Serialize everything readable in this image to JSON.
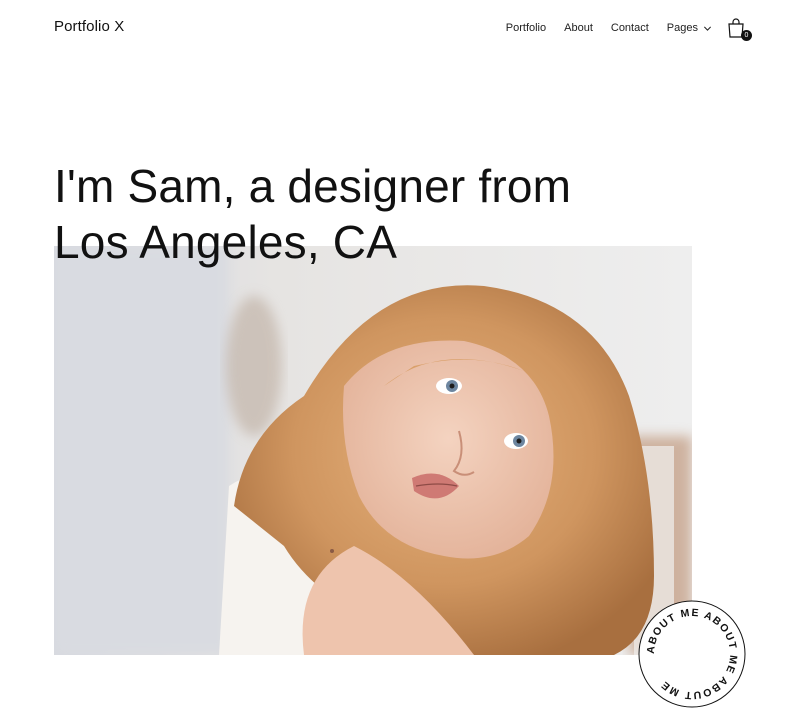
{
  "header": {
    "logo": "Portfolio X",
    "nav": [
      {
        "label": "Portfolio"
      },
      {
        "label": "About"
      },
      {
        "label": "Contact"
      },
      {
        "label": "Pages"
      }
    ],
    "cart_count": "0"
  },
  "hero": {
    "title_line1": "I'm Sam, a designer from",
    "title_line2": "Los Angeles, CA"
  },
  "badge": {
    "text": "ABOUT ME  ABOUT ME  ABOUT ME"
  },
  "icons": {
    "cart": "shopping-bag-icon",
    "pages_dropdown": "chevron-down-icon"
  }
}
